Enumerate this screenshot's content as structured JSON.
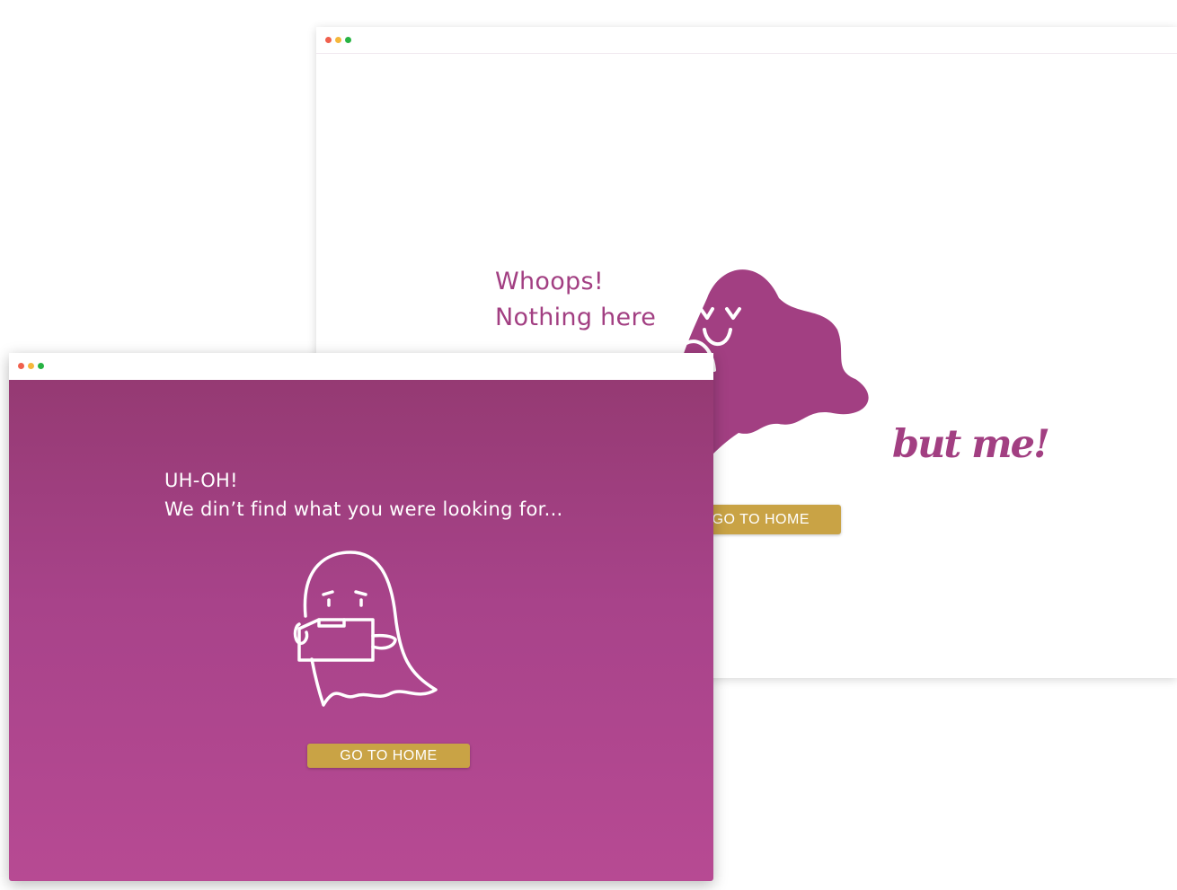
{
  "back_window": {
    "heading_line1": "Whoops!",
    "heading_line2": "Nothing here",
    "tagline": "but me!",
    "button_label": "GO TO HOME"
  },
  "front_window": {
    "heading_line1": "UH-OH!",
    "heading_line2": "We din’t find what you were looking for...",
    "button_label": "GO TO HOME"
  },
  "colors": {
    "brand_purple": "#a23f82",
    "gradient_top": "#953a73",
    "gradient_bottom": "#b74a93",
    "button_gold": "#c9a345",
    "dot_close": "#f0604d",
    "dot_minimize": "#f5b73b",
    "dot_maximize": "#27b343"
  },
  "icons": [
    "window-close-dot",
    "window-minimize-dot",
    "window-maximize-dot",
    "ghost-with-cape-illustration",
    "ghost-holding-box-illustration"
  ]
}
